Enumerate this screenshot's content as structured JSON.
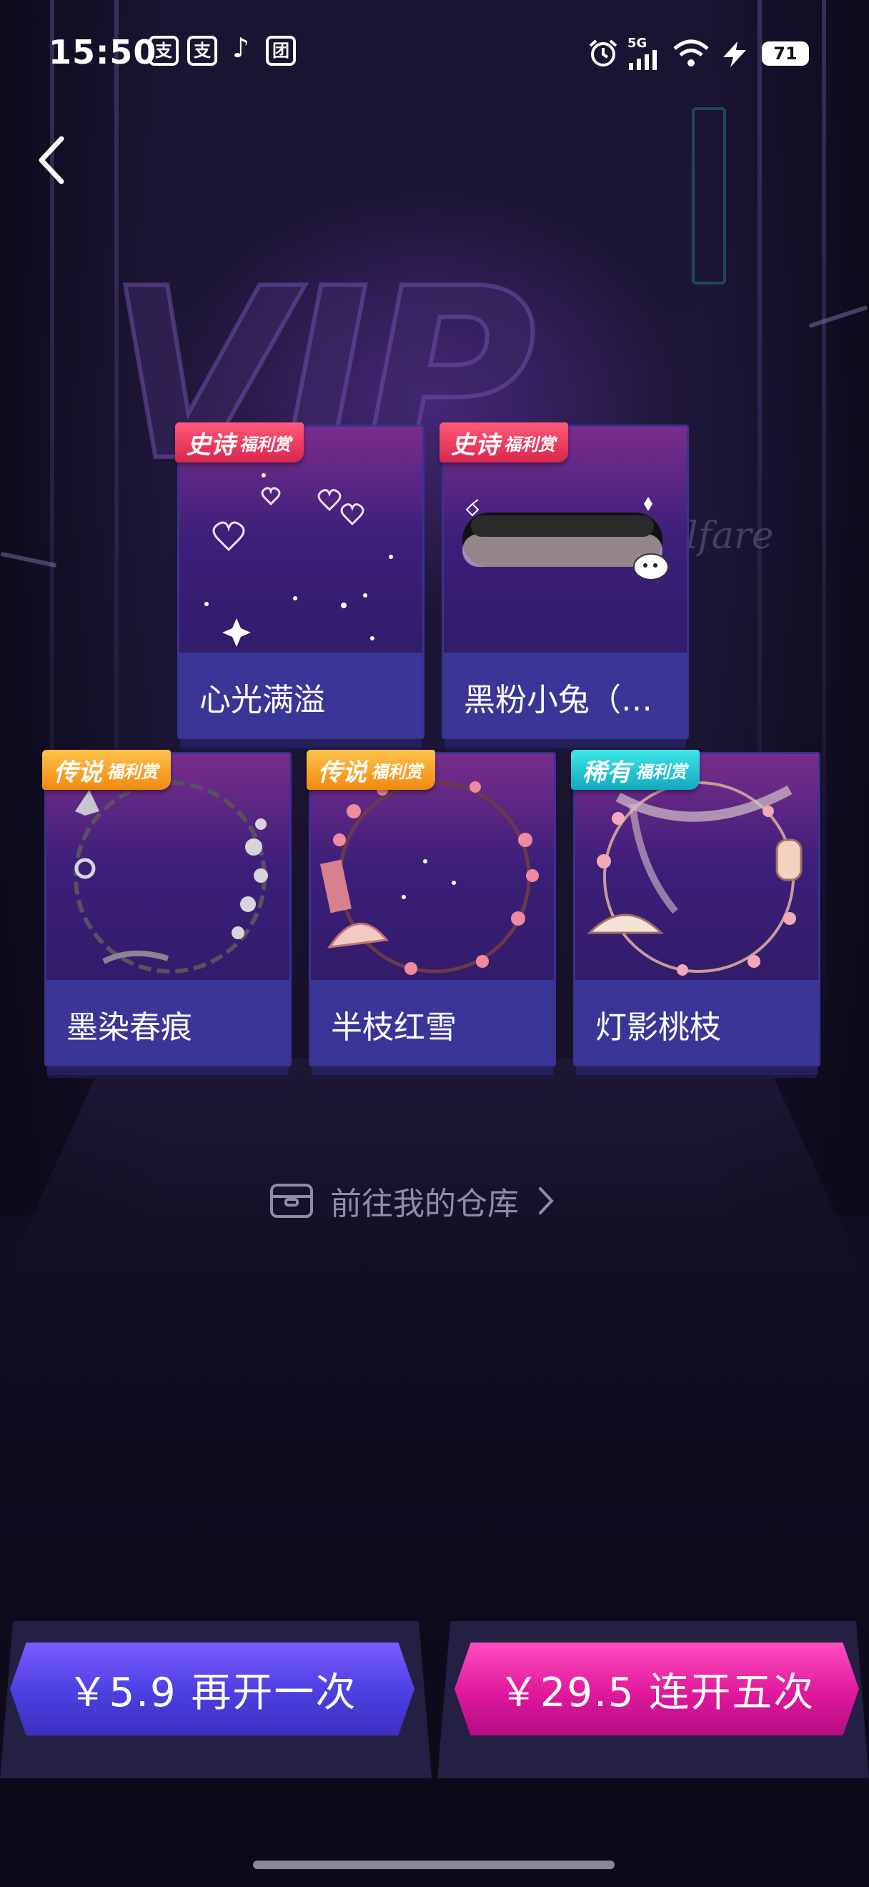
{
  "status_bar": {
    "time": "15:50",
    "app_icons": [
      "支",
      "支",
      "♪",
      "团"
    ],
    "network": "5G",
    "battery": "71"
  },
  "back_icon": "chevron-left-icon",
  "background_text": {
    "logo": "VIP",
    "script": "lfare"
  },
  "cards": [
    {
      "name": "心光满溢",
      "rarity": "史诗",
      "tag": "福利赏",
      "rarity_color": "#e0325a"
    },
    {
      "name": "黑粉小兔（…",
      "rarity": "史诗",
      "tag": "福利赏",
      "rarity_color": "#e0325a"
    },
    {
      "name": "墨染春痕",
      "rarity": "传说",
      "tag": "福利赏",
      "rarity_color": "#f29a1a"
    },
    {
      "name": "半枝红雪",
      "rarity": "传说",
      "tag": "福利赏",
      "rarity_color": "#f29a1a"
    },
    {
      "name": "灯影桃枝",
      "rarity": "稀有",
      "tag": "福利赏",
      "rarity_color": "#1cb8cc"
    }
  ],
  "warehouse_link": {
    "label": "前往我的仓库",
    "icon": "box-icon",
    "arrow": "chevron-right-icon"
  },
  "buttons": {
    "open_again": "￥5.9 再开一次",
    "open_five": "￥29.5 连开五次"
  }
}
